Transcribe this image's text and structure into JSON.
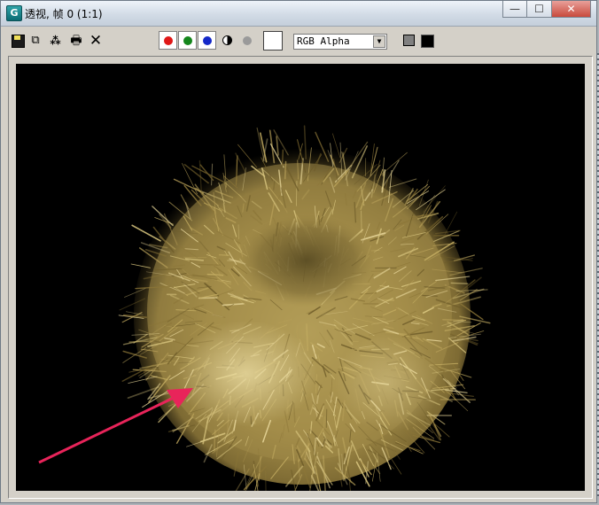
{
  "window": {
    "title": "透视, 帧 0 (1:1)",
    "app_icon_letter": "G",
    "controls": {
      "minimize_icon": "minimize-icon",
      "maximize_icon": "maximize-icon",
      "close_icon": "close-icon",
      "minimize_glyph": "—",
      "maximize_glyph": "☐",
      "close_glyph": "✕"
    }
  },
  "toolbar": {
    "icons": [
      "save-icon",
      "copy-icon",
      "clone-window-icon",
      "print-icon",
      "clear-icon"
    ],
    "copy_glyph": "⧉",
    "clone_glyph": "⁂",
    "print_glyph": "🖶",
    "clear_glyph": "✕",
    "channels": [
      {
        "name": "red-channel",
        "color": "#e01818"
      },
      {
        "name": "green-channel",
        "color": "#14861c"
      },
      {
        "name": "blue-channel",
        "color": "#1428c8"
      }
    ],
    "channel_display": {
      "selected": "RGB Alpha",
      "arrow": "▼"
    },
    "swatch_color": "#ffffff"
  },
  "viewport": {
    "background": "#000000",
    "render_subject": "fur-ball",
    "annotation_arrow_color": "#e8245a"
  }
}
